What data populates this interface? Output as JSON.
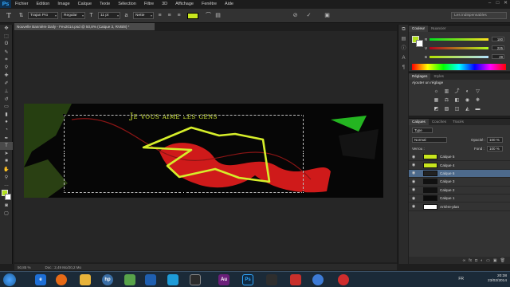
{
  "app": {
    "logo": "Ps",
    "menu": [
      "Fichier",
      "Edition",
      "Image",
      "Calque",
      "Texte",
      "Sélection",
      "Filtre",
      "3D",
      "Affichage",
      "Fenêtre",
      "Aide"
    ]
  },
  "options": {
    "tool_glyph": "T",
    "font_family": "Trajan Pro",
    "font_style": "Regular",
    "font_size": "11 pt",
    "antialias": "Nette",
    "text_color": "#c8e61e",
    "workspace": "Les indispensables"
  },
  "document": {
    "tab_title": "Nouvelle Bannière Daily - Fev2014.psd @ 50,8% (Calque 3, RVB/8) *",
    "banner_text": "Je vous aime les gens",
    "zoom": "50,85 %",
    "doc_info": "Doc : 2,49 Mo/20,2 Mo"
  },
  "color_panel": {
    "tabs": [
      "Couleur",
      "Nuancier"
    ],
    "fg_color": "#b2e11d",
    "bg_color": "#ffffff",
    "r_label": "R",
    "r_value": "180",
    "r_level": 0.706,
    "g_label": "V",
    "g_value": "225",
    "g_level": 0.882,
    "b_label": "B",
    "b_value": "29",
    "b_level": 0.114
  },
  "adjustments_panel": {
    "tabs": [
      "Réglages",
      "Styles"
    ],
    "title": "Ajouter un réglage"
  },
  "layers_panel": {
    "tabs": [
      "Calques",
      "Couches",
      "Tracés"
    ],
    "filter_label": "Type",
    "blend_mode": "Normal",
    "opacity_label": "Opacité :",
    "opacity_value": "100 %",
    "lock_label": "Verrou :",
    "fill_label": "Fond :",
    "fill_value": "100 %",
    "layers": [
      {
        "name": "Calque 5",
        "selected": false,
        "thumb": "#c8e61e"
      },
      {
        "name": "Calque 4",
        "selected": false,
        "thumb": "#c8e61e"
      },
      {
        "name": "Calque 6",
        "selected": true,
        "thumb": "#222222"
      },
      {
        "name": "Calque 3",
        "selected": false,
        "thumb": "#111111"
      },
      {
        "name": "Calque 2",
        "selected": false,
        "thumb": "#111111"
      },
      {
        "name": "Calque 1",
        "selected": false,
        "thumb": "#0b0b0b"
      },
      {
        "name": "Arrière-plan",
        "selected": false,
        "thumb": "#ffffff"
      }
    ]
  },
  "taskbar": {
    "language": "FR",
    "time": "20:38",
    "date": "23/02/2014"
  }
}
